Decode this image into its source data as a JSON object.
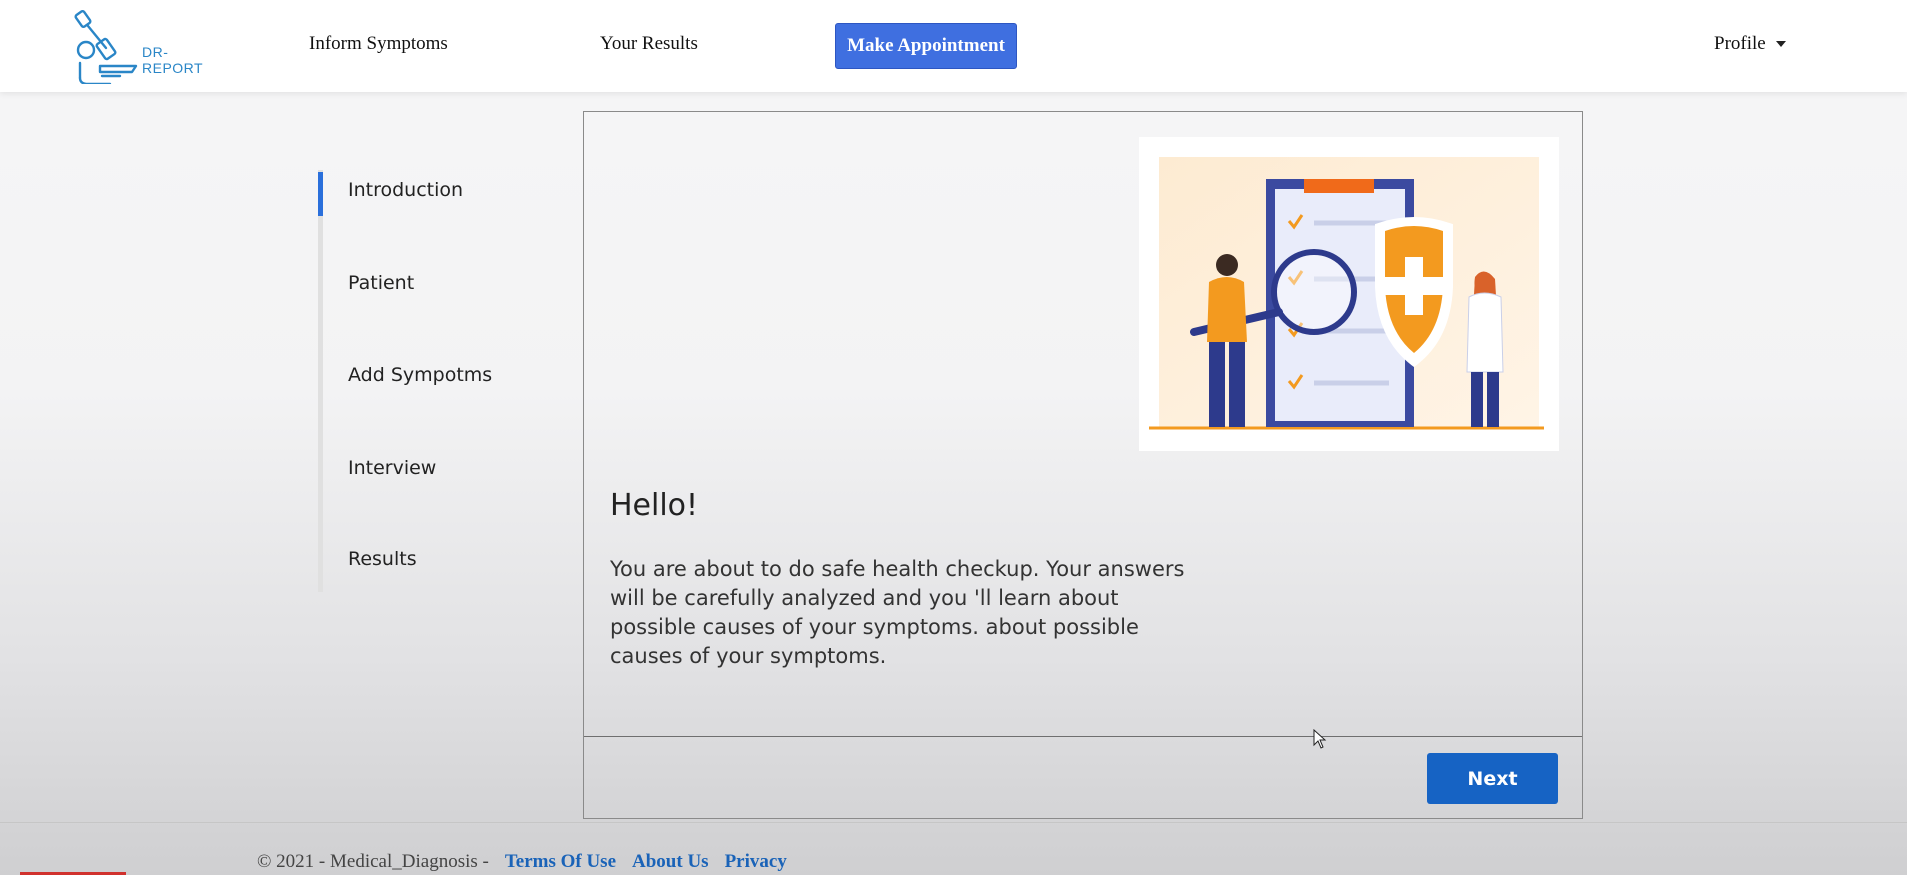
{
  "navbar": {
    "brand": "DR-REPORT",
    "links": [
      "Inform Symptoms",
      "Your Results"
    ],
    "cta_label": "Make Appointment",
    "profile_label": "Profile"
  },
  "steps": {
    "active_index": 0,
    "items": [
      "Introduction",
      "Patient",
      "Add Sympotms",
      "Interview",
      "Results"
    ]
  },
  "card": {
    "title": "Hello!",
    "body": "You are about to do safe health checkup. Your answers will be carefully analyzed and you 'll learn about possible causes of your symptoms. about possible causes of your symptoms.",
    "next_label": "Next"
  },
  "footer": {
    "copyright": "© 2021 - Medical_Diagnosis -",
    "links": [
      "Terms Of Use",
      "About Us",
      "Privacy"
    ]
  },
  "colors": {
    "primary": "#3f6fe0",
    "next_button": "#1663c4",
    "step_active": "#2a6fdb",
    "illustration_accent": "#f39a1f",
    "illustration_navy": "#2d3a8c"
  }
}
